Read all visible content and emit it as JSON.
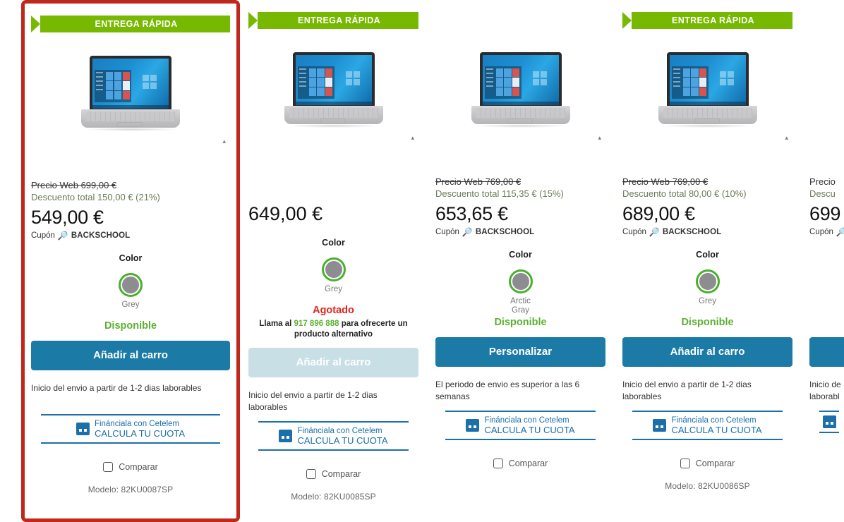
{
  "labels": {
    "banner": "ENTREGA RÁPIDA",
    "color_title": "Color",
    "compare": "Comparar",
    "model_prefix": "Modelo:",
    "cupon_prefix": "Cupón",
    "precio_web_prefix": "Precio Web",
    "descuento_prefix": "Descuento total",
    "cetelem_line1": "Finánciala con Cetelem",
    "cetelem_line2": "CALCULA TU CUOTA"
  },
  "colors": {
    "banner_green": "#76b900",
    "button_blue": "#1b7ba6",
    "button_disabled": "#c9dfe6",
    "available_green": "#5bb031",
    "soldout_red": "#e1251b",
    "selection_red": "#c0281c",
    "link_blue": "#1b6faa",
    "discount_olive": "#6b7b55",
    "swatch_ring_green": "#4cae2e",
    "swatch_grey": "#8d8d91"
  },
  "products": [
    {
      "id": "card-1",
      "selected": true,
      "banner": "ENTREGA RÁPIDA",
      "has_banner": true,
      "precio_web": "Precio Web 699,00 €",
      "precio_web_value": "699,00 €",
      "descuento": "Descuento total 150,00 € (21%)",
      "descuento_value": "150,00 €",
      "descuento_pct": "21%",
      "price": "549,00 €",
      "cupon_label": "Cupón",
      "cupon_code": "BACKSCHOOL",
      "color_title": "Color",
      "color_name": "Grey",
      "stock": "Disponible",
      "stock_state": "available",
      "callout": "",
      "button": "Añadir al carro",
      "button_enabled": true,
      "shipping": "Inicio del envio a partir de 1-2 dias laborables",
      "cetelem_line1": "Finánciala con Cetelem",
      "cetelem_line2": "CALCULA TU CUOTA",
      "compare": "Comparar",
      "model": "Modelo:  82KU0087SP"
    },
    {
      "id": "card-2",
      "selected": false,
      "banner": "ENTREGA RÁPIDA",
      "has_banner": true,
      "precio_web": "",
      "descuento": "",
      "price": "649,00 €",
      "cupon_label": "",
      "cupon_code": "",
      "color_title": "Color",
      "color_name": "Grey",
      "stock": "Agotado",
      "stock_state": "soldout",
      "callout_pre": "Llama al ",
      "callout_phone": "917 896 888",
      "callout_post": " para ofrecerte un producto alternativo",
      "button": "Añadir al carro",
      "button_enabled": false,
      "shipping": "Inicio del envio a partir de 1-2 dias laborables",
      "cetelem_line1": "Finánciala con Cetelem",
      "cetelem_line2": "CALCULA TU CUOTA",
      "compare": "Comparar",
      "model": "Modelo:  82KU0085SP"
    },
    {
      "id": "card-3",
      "selected": false,
      "banner": "",
      "has_banner": false,
      "precio_web": "Precio Web 769,00 €",
      "precio_web_value": "769,00 €",
      "descuento": "Descuento total 115,35 € (15%)",
      "descuento_value": "115,35 €",
      "descuento_pct": "15%",
      "price": "653,65 €",
      "cupon_label": "Cupón",
      "cupon_code": "BACKSCHOOL",
      "color_title": "Color",
      "color_name": "Arctic\nGray",
      "color_name_l1": "Arctic",
      "color_name_l2": "Gray",
      "stock": "Disponible",
      "stock_state": "available",
      "callout": "",
      "button": "Personalizar",
      "button_enabled": true,
      "shipping": "El periodo de envio es superior a las 6 semanas",
      "cetelem_line1": "Finánciala con Cetelem",
      "cetelem_line2": "CALCULA TU CUOTA",
      "compare": "Comparar",
      "model": ""
    },
    {
      "id": "card-4",
      "selected": false,
      "banner": "ENTREGA RÁPIDA",
      "has_banner": true,
      "precio_web": "Precio Web 769,00 €",
      "precio_web_value": "769,00 €",
      "descuento": "Descuento total 80,00 € (10%)",
      "descuento_value": "80,00 €",
      "descuento_pct": "10%",
      "price": "689,00 €",
      "cupon_label": "Cupón",
      "cupon_code": "BACKSCHOOL",
      "color_title": "Color",
      "color_name": "Grey",
      "stock": "Disponible",
      "stock_state": "available",
      "callout": "",
      "button": "Añadir al carro",
      "button_enabled": true,
      "shipping": "Inicio del envio a partir de 1-2 dias laborables",
      "cetelem_line1": "Finánciala con Cetelem",
      "cetelem_line2": "CALCULA TU CUOTA",
      "compare": "Comparar",
      "model": "Modelo:  82KU0086SP"
    },
    {
      "id": "card-5-partial",
      "selected": false,
      "banner": "",
      "has_banner": false,
      "precio_web": "Precio",
      "descuento": "Descu",
      "price": "699",
      "cupon_label": "Cupón",
      "cupon_code": "",
      "color_title": "",
      "color_name": "",
      "stock": "",
      "stock_state": "",
      "button": "",
      "button_enabled": true,
      "shipping": "Inicio de laborabl",
      "shipping_l1": "Inicio de",
      "shipping_l2": "laborabl",
      "cetelem_line1": "",
      "cetelem_line2": "",
      "compare": "",
      "model": ""
    }
  ]
}
